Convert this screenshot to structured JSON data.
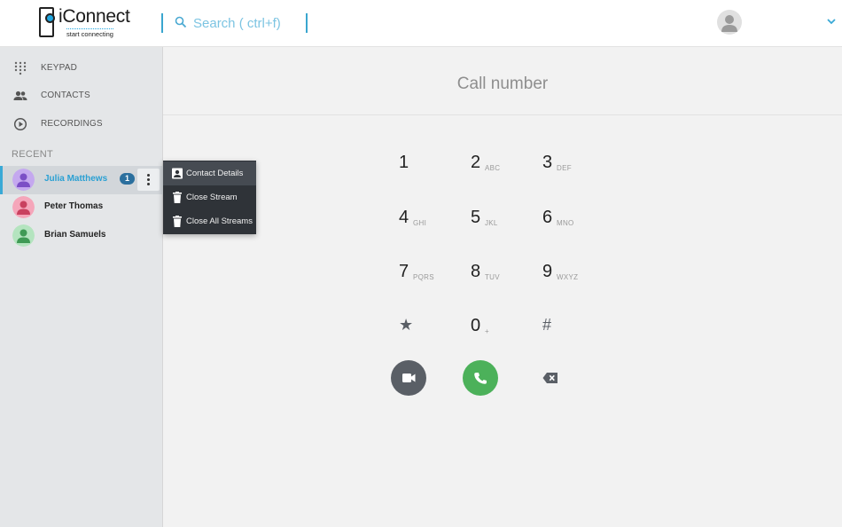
{
  "header": {
    "logo_text": "iConnect",
    "logo_tagline": "start connecting",
    "search_placeholder": "Search ( ctrl+f)",
    "search_value": "",
    "avatar_icon": "user-avatar-icon",
    "menu_icon": "chevron-down-icon"
  },
  "sidebar": {
    "nav": [
      {
        "label": "KEYPAD",
        "icon": "keypad-grid-icon"
      },
      {
        "label": "CONTACTS",
        "icon": "people-icon"
      },
      {
        "label": "RECORDINGS",
        "icon": "play-circle-icon"
      }
    ],
    "recent_label": "RECENT",
    "contacts": [
      {
        "name": "Julia Matthews",
        "badge": "1",
        "color": "#9b6fd6",
        "active": true
      },
      {
        "name": "Peter Thomas",
        "color": "#e0607e",
        "active": false
      },
      {
        "name": "Brian Samuels",
        "color": "#5dba72",
        "active": false
      }
    ]
  },
  "context_menu": {
    "items": [
      {
        "label": "Contact Details",
        "icon": "contact-card-icon"
      },
      {
        "label": "Close Stream",
        "icon": "trash-icon"
      },
      {
        "label": "Close All Streams",
        "icon": "trash-icon"
      }
    ]
  },
  "main": {
    "title": "Call number",
    "keys": [
      {
        "digit": "1",
        "letters": ""
      },
      {
        "digit": "2",
        "letters": "ABC"
      },
      {
        "digit": "3",
        "letters": "DEF"
      },
      {
        "digit": "4",
        "letters": "GHI"
      },
      {
        "digit": "5",
        "letters": "JKL"
      },
      {
        "digit": "6",
        "letters": "MNO"
      },
      {
        "digit": "7",
        "letters": "PQRS"
      },
      {
        "digit": "8",
        "letters": "TUV"
      },
      {
        "digit": "9",
        "letters": "WXYZ"
      },
      {
        "digit": "★",
        "letters": ""
      },
      {
        "digit": "0",
        "letters": "+"
      },
      {
        "digit": "#",
        "letters": ""
      }
    ],
    "video_icon": "video-camera-icon",
    "call_icon": "phone-icon",
    "backspace_icon": "backspace-icon"
  },
  "colors": {
    "accent": "#39a9d6",
    "call_green": "#4cb15a",
    "video_grey": "#5a5f66",
    "menu_dark": "#2f3338",
    "badge_blue": "#2b6f9e"
  }
}
